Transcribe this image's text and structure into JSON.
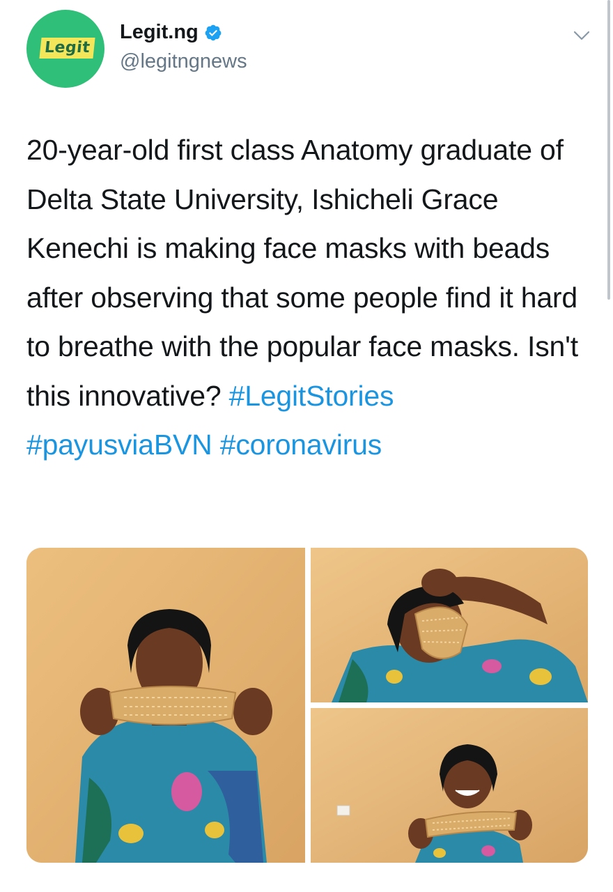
{
  "author": {
    "avatar_logo_text": "Legit",
    "display_name": "Legit.ng",
    "handle": "@legitngnews",
    "verified": true
  },
  "tweet": {
    "text_parts": [
      "20-year-old first class Anatomy graduate of Delta State University, Ishicheli Grace Kenechi is making face masks with beads after observing that some people find it hard to breathe with the popular face masks. Isn't this innovative? "
    ],
    "hashtags": [
      "#LegitStories",
      "#payusviaBVN",
      "#coronavirus"
    ]
  },
  "colors": {
    "hashtag": "#1b95e0",
    "text": "#14171a",
    "secondary": "#657786",
    "avatar_bg": "#2fbf78",
    "verified": "#1da1f2"
  },
  "icons": {
    "verified": "verified-badge-icon",
    "menu": "chevron-down-icon"
  }
}
